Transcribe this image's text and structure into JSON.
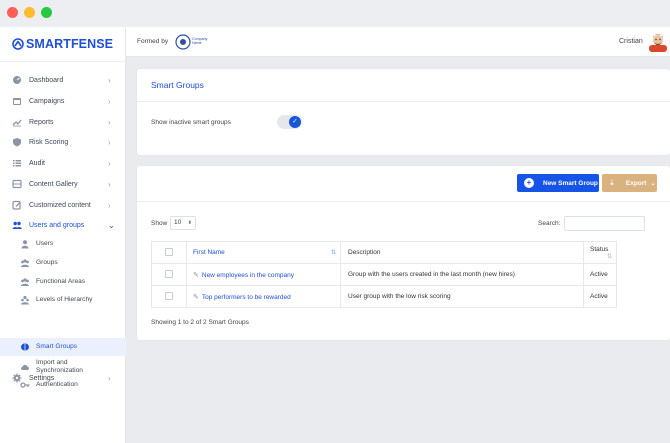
{
  "window": {
    "controls": {
      "close_color": "#ff5f57",
      "minimize_color": "#febc2e",
      "maximize_color": "#28c840"
    }
  },
  "brand": {
    "name": "SMARTFENSE",
    "color": "#1f4fd6"
  },
  "topbar": {
    "formed_by": "Formed by",
    "company_logo_text": "Company Name",
    "user_name": "Cristian"
  },
  "sidebar": {
    "items": [
      {
        "label": "Dashboard",
        "icon": "dashboard-icon"
      },
      {
        "label": "Campaigns",
        "icon": "calendar-icon"
      },
      {
        "label": "Reports",
        "icon": "chart-icon"
      },
      {
        "label": "Risk Scoring",
        "icon": "shield-icon"
      },
      {
        "label": "Audit",
        "icon": "list-icon"
      },
      {
        "label": "Content Gallery",
        "icon": "gallery-icon"
      },
      {
        "label": "Customized content",
        "icon": "edit-icon"
      },
      {
        "label": "Users and groups",
        "icon": "users-icon"
      },
      {
        "label": "Settings",
        "icon": "gear-icon"
      }
    ],
    "subitems": [
      {
        "label": "Users",
        "icon": "user-icon"
      },
      {
        "label": "Groups",
        "icon": "group-icon"
      },
      {
        "label": "Functional Areas",
        "icon": "functional-areas-icon"
      },
      {
        "label": "Levels of Hierarchy",
        "icon": "hierarchy-icon"
      },
      {
        "label": "Smart Groups",
        "icon": "brain-icon"
      },
      {
        "label": "Import and Synchronization",
        "icon": "cloud-icon"
      },
      {
        "label": "Authentication",
        "icon": "key-icon"
      }
    ]
  },
  "smart_groups_card": {
    "title": "Smart Groups",
    "toggle_label": "Show inactive smart groups",
    "toggle_on": true
  },
  "table_card": {
    "new_button": "New Smart Group",
    "export_button": "Export",
    "show_label": "Show",
    "page_size": "10",
    "search_label": "Search:",
    "search_value": "",
    "columns": {
      "name": "First Name",
      "description": "Description",
      "status": "Status"
    },
    "rows": [
      {
        "name": "New employees in the company",
        "description": "Group with the users created in the last month (new hires)",
        "status": "Active"
      },
      {
        "name": "Top performers to be rewarded",
        "description": "User group with the low risk scoring",
        "status": "Active"
      }
    ],
    "info": "Showing 1 to 2 of 2 Smart Groups"
  },
  "colors": {
    "primary": "#1654e8",
    "export": "#d9b27f",
    "background": "#e9ebef"
  }
}
